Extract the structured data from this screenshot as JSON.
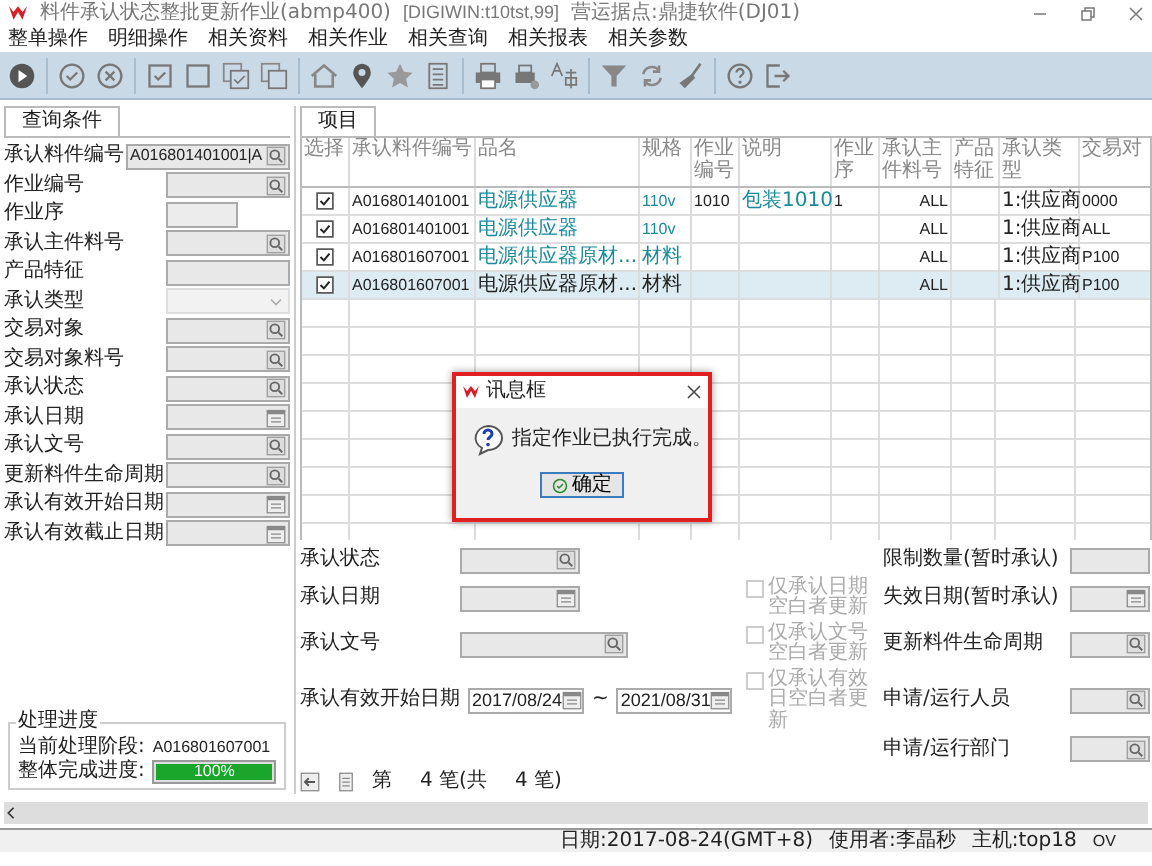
{
  "window": {
    "title": "料件承认状态整批更新作业(abmp400)",
    "env": "[DIGIWIN:t10tst,99]",
    "site": "营运据点:鼎捷软件(DJ01)"
  },
  "menu": [
    "整单操作",
    "明细操作",
    "相关资料",
    "相关作业",
    "相关查询",
    "相关报表",
    "相关参数"
  ],
  "query_panel": {
    "tab": "查询条件",
    "fields": [
      {
        "label": "承认料件编号",
        "value": "A016801401001|A",
        "kind": "lookup"
      },
      {
        "label": "作业编号",
        "kind": "lookup"
      },
      {
        "label": "作业序",
        "kind": "short"
      },
      {
        "label": "承认主件料号",
        "kind": "lookup"
      },
      {
        "label": "产品特征",
        "kind": "plain"
      },
      {
        "label": "承认类型",
        "kind": "dropdown"
      },
      {
        "label": "交易对象",
        "kind": "lookup"
      },
      {
        "label": "交易对象料号",
        "kind": "lookup"
      },
      {
        "label": "承认状态",
        "kind": "lookup"
      },
      {
        "label": "承认日期",
        "kind": "calendar"
      },
      {
        "label": "承认文号",
        "kind": "lookup"
      },
      {
        "label": "更新料件生命周期",
        "kind": "lookup"
      },
      {
        "label": "承认有效开始日期",
        "kind": "calendar"
      },
      {
        "label": "承认有效截止日期",
        "kind": "calendar"
      }
    ]
  },
  "progress": {
    "title": "处理进度",
    "stage_label": "当前处理阶段:",
    "stage": "A016801607001",
    "overall_label": "整体完成进度:",
    "level": 1,
    "reading": "100%"
  },
  "items_panel": {
    "tab": "项目",
    "table": {
      "select_header": "选择",
      "columns": [
        "承认料件编号",
        "品名",
        "规格",
        "作业编号",
        "说明",
        "作业序",
        "承认主件料号",
        "产品特征",
        "承认类型",
        "交易对"
      ],
      "rows": [
        {
          "checked": true,
          "selected": false,
          "cells": [
            "A016801401001",
            "电源供应器",
            "110v",
            "1010",
            "包装1010",
            "1",
            "ALL",
            null,
            "1:供应商",
            "0000"
          ]
        },
        {
          "checked": true,
          "selected": false,
          "cells": [
            "A016801401001",
            "电源供应器",
            "110v",
            null,
            null,
            null,
            "ALL",
            null,
            "1:供应商",
            "ALL"
          ]
        },
        {
          "checked": true,
          "selected": false,
          "cells": [
            "A016801607001",
            "电源供应器原材...",
            "材料",
            null,
            null,
            null,
            "ALL",
            null,
            "1:供应商",
            "P100"
          ]
        },
        {
          "checked": true,
          "selected": true,
          "cells": [
            "A016801607001",
            "电源供应器原材...",
            "材料",
            null,
            null,
            null,
            "ALL",
            null,
            "1:供应商",
            "P100"
          ]
        }
      ]
    }
  },
  "bottom_form": {
    "left_fields": [
      {
        "label": "承认状态",
        "kind": "lookup"
      },
      {
        "label": "承认日期",
        "kind": "calendar"
      },
      {
        "label": "承认文号",
        "kind": "lookup"
      }
    ],
    "date_range": {
      "label": "承认有效开始日期",
      "from": "2017/08/24",
      "separator": "~",
      "to": "2021/08/31"
    },
    "options": [
      {
        "label": "仅承认日期空白者更新",
        "checked": false,
        "disabled": true
      },
      {
        "label": "仅承认文号空白者更新",
        "checked": false,
        "disabled": true
      },
      {
        "label": "仅承认有效日空白者更新",
        "checked": false,
        "disabled": true
      }
    ],
    "right_fields": [
      {
        "label": "限制数量(暂时承认)",
        "kind": "plain"
      },
      {
        "label": "失效日期(暂时承认)",
        "kind": "calendar"
      },
      {
        "label": "更新料件生命周期",
        "kind": "lookup"
      },
      {
        "label": "申请/运行人员",
        "kind": "lookup"
      },
      {
        "label": "申请/运行部门",
        "kind": "lookup"
      }
    ]
  },
  "pager": [
    "第",
    "4 笔(共",
    "4 笔)"
  ],
  "dialog": {
    "title": "讯息框",
    "message": "指定作业已执行完成。",
    "button": "确定"
  },
  "status_bar": [
    "日期:2017-08-24(GMT+8)",
    "使用者:李晶秒",
    "主机:top18",
    "OV"
  ]
}
